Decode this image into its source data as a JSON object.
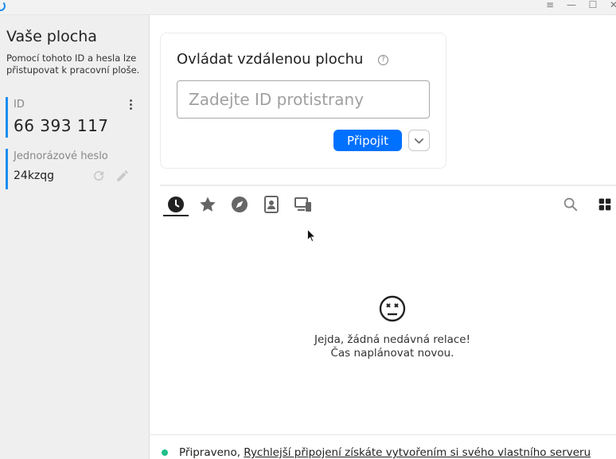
{
  "window": {
    "menu_glyph": "≡",
    "minimize_glyph": "—",
    "maximize_glyph": "☐",
    "close_glyph": "✕"
  },
  "sidebar": {
    "title": "Vaše plocha",
    "description": "Pomocí tohoto ID a hesla lze přistupovat k pracovní ploše.",
    "id_card": {
      "label": "ID",
      "value": "66 393 117"
    },
    "password_card": {
      "label": "Jednorázové heslo",
      "value": "24kzqg"
    }
  },
  "connect": {
    "title": "Ovládat vzdálenou plochu",
    "input_placeholder": "Zadejte ID protistrany",
    "input_value": "",
    "connect_label": "Připojit"
  },
  "tabs": [
    {
      "icon": "clock-icon",
      "selected": true
    },
    {
      "icon": "star-icon",
      "selected": false
    },
    {
      "icon": "compass-icon",
      "selected": false
    },
    {
      "icon": "address-book-icon",
      "selected": false
    },
    {
      "icon": "devices-icon",
      "selected": false
    }
  ],
  "empty_state": {
    "line1": "Jejda, žádná nedávná relace!",
    "line2": "Čas naplánovat novou."
  },
  "status": {
    "prefix": "Připraveno, ",
    "link": "Rychlejší připojení získáte vytvořením si svého vlastního serveru"
  },
  "colors": {
    "accent": "#0071ff",
    "card_border": "#1a8df0",
    "status_ok": "#22c08a"
  }
}
